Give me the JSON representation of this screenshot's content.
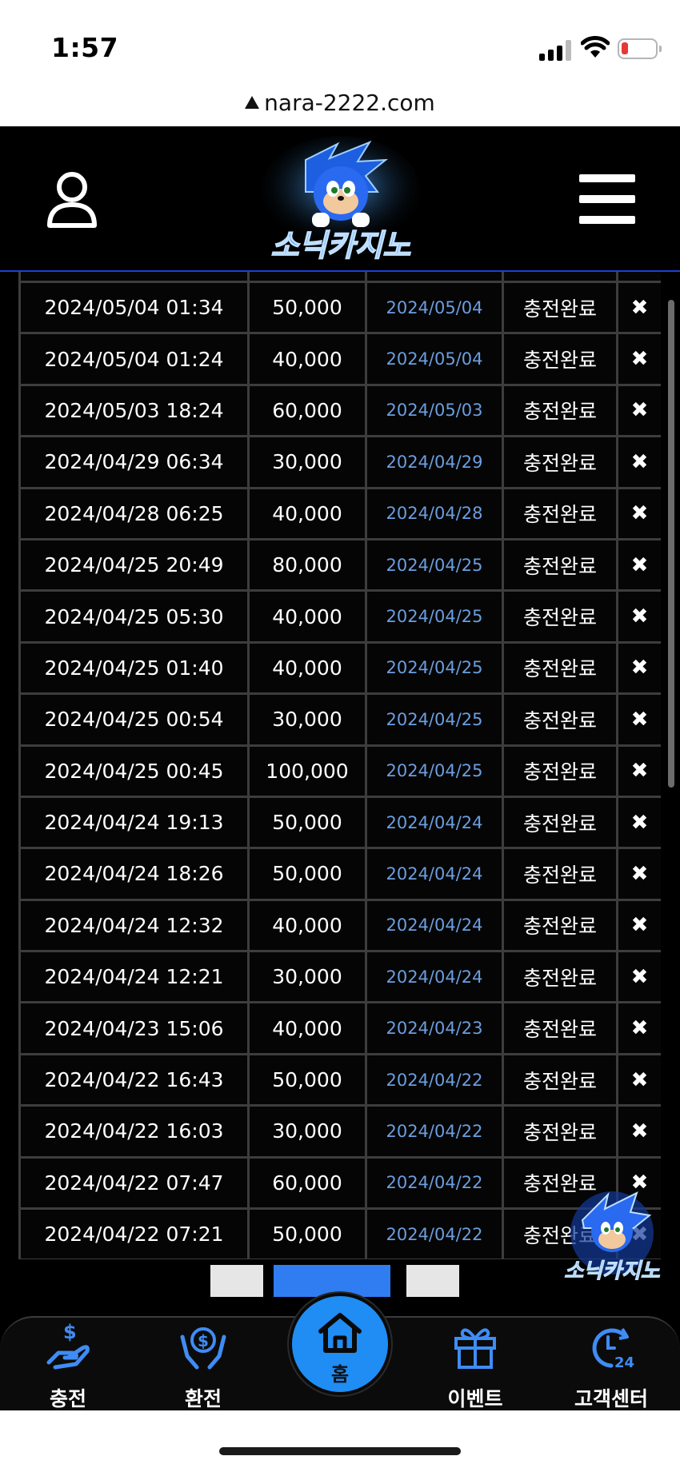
{
  "status_bar": {
    "time": "1:57"
  },
  "browser": {
    "url": "nara-2222.com"
  },
  "header": {
    "logo_text": "소닉카지노"
  },
  "table": {
    "rows": [
      {
        "requested": "",
        "amount": "",
        "processed": "",
        "status": "",
        "action": ""
      },
      {
        "requested": "2024/05/04 01:34",
        "amount": "50,000",
        "processed": "2024/05/04",
        "status": "충전완료",
        "action": "✖"
      },
      {
        "requested": "2024/05/04 01:24",
        "amount": "40,000",
        "processed": "2024/05/04",
        "status": "충전완료",
        "action": "✖"
      },
      {
        "requested": "2024/05/03 18:24",
        "amount": "60,000",
        "processed": "2024/05/03",
        "status": "충전완료",
        "action": "✖"
      },
      {
        "requested": "2024/04/29 06:34",
        "amount": "30,000",
        "processed": "2024/04/29",
        "status": "충전완료",
        "action": "✖"
      },
      {
        "requested": "2024/04/28 06:25",
        "amount": "40,000",
        "processed": "2024/04/28",
        "status": "충전완료",
        "action": "✖"
      },
      {
        "requested": "2024/04/25 20:49",
        "amount": "80,000",
        "processed": "2024/04/25",
        "status": "충전완료",
        "action": "✖"
      },
      {
        "requested": "2024/04/25 05:30",
        "amount": "40,000",
        "processed": "2024/04/25",
        "status": "충전완료",
        "action": "✖"
      },
      {
        "requested": "2024/04/25 01:40",
        "amount": "40,000",
        "processed": "2024/04/25",
        "status": "충전완료",
        "action": "✖"
      },
      {
        "requested": "2024/04/25 00:54",
        "amount": "30,000",
        "processed": "2024/04/25",
        "status": "충전완료",
        "action": "✖"
      },
      {
        "requested": "2024/04/25 00:45",
        "amount": "100,000",
        "processed": "2024/04/25",
        "status": "충전완료",
        "action": "✖"
      },
      {
        "requested": "2024/04/24 19:13",
        "amount": "50,000",
        "processed": "2024/04/24",
        "status": "충전완료",
        "action": "✖"
      },
      {
        "requested": "2024/04/24 18:26",
        "amount": "50,000",
        "processed": "2024/04/24",
        "status": "충전완료",
        "action": "✖"
      },
      {
        "requested": "2024/04/24 12:32",
        "amount": "40,000",
        "processed": "2024/04/24",
        "status": "충전완료",
        "action": "✖"
      },
      {
        "requested": "2024/04/24 12:21",
        "amount": "30,000",
        "processed": "2024/04/24",
        "status": "충전완료",
        "action": "✖"
      },
      {
        "requested": "2024/04/23 15:06",
        "amount": "40,000",
        "processed": "2024/04/23",
        "status": "충전완료",
        "action": "✖"
      },
      {
        "requested": "2024/04/22 16:43",
        "amount": "50,000",
        "processed": "2024/04/22",
        "status": "충전완료",
        "action": "✖"
      },
      {
        "requested": "2024/04/22 16:03",
        "amount": "30,000",
        "processed": "2024/04/22",
        "status": "충전완료",
        "action": "✖"
      },
      {
        "requested": "2024/04/22 07:47",
        "amount": "60,000",
        "processed": "2024/04/22",
        "status": "충전완료",
        "action": "✖"
      },
      {
        "requested": "2024/04/22 07:21",
        "amount": "50,000",
        "processed": "2024/04/22",
        "status": "충전완료",
        "action": "✖"
      }
    ]
  },
  "pagination": {
    "prev_label": "‹",
    "next_label": "›",
    "current_page": ""
  },
  "bottom_nav": {
    "deposit": "충전",
    "withdraw": "환전",
    "home": "홈",
    "event": "이벤트",
    "support": "고객센터"
  },
  "icons": {
    "user": "user-icon",
    "menu": "hamburger-menu-icon",
    "deposit": "hand-coin-icon",
    "withdraw": "hand-dollar-icon",
    "home": "home-icon",
    "event": "gift-icon",
    "support": "24h-support-icon"
  },
  "colors": {
    "accent": "#1f8df3",
    "processed_date": "#6b9ee0",
    "header_border": "#1e40d6"
  }
}
